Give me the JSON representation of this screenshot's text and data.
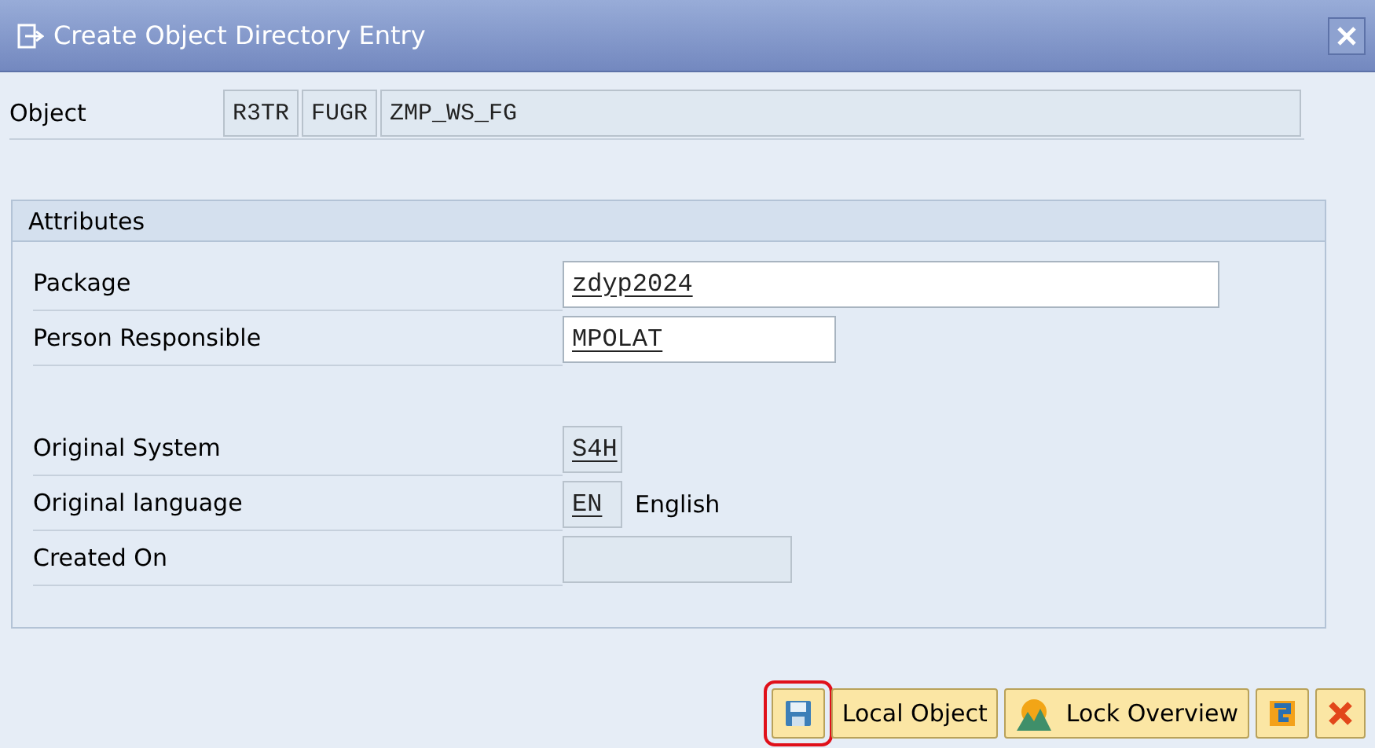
{
  "window": {
    "title": "Create Object Directory Entry"
  },
  "object": {
    "label": "Object",
    "parts": [
      "R3TR",
      "FUGR",
      "ZMP_WS_FG"
    ]
  },
  "attributes": {
    "title": "Attributes",
    "rows": [
      {
        "label": "Package",
        "kind": "input",
        "value": "zdyp2024"
      },
      {
        "label": "Person Responsible",
        "kind": "input",
        "value": "MPOLAT"
      },
      {
        "kind": "spacer"
      },
      {
        "label": "Original System",
        "kind": "display",
        "value": "S4H"
      },
      {
        "label": "Original language",
        "kind": "display",
        "value": "EN",
        "description": "English"
      },
      {
        "label": "Created On",
        "kind": "display"
      }
    ]
  },
  "toolbar": {
    "buttons": [
      {
        "kind": "save",
        "highlighted": true
      },
      {
        "kind": "text",
        "label": "Local Object",
        "highlighted": false
      },
      {
        "kind": "lock",
        "label": "Lock Overview",
        "highlighted": false
      },
      {
        "kind": "hierarchy",
        "highlighted": false
      },
      {
        "kind": "cancel",
        "highlighted": false
      }
    ]
  }
}
